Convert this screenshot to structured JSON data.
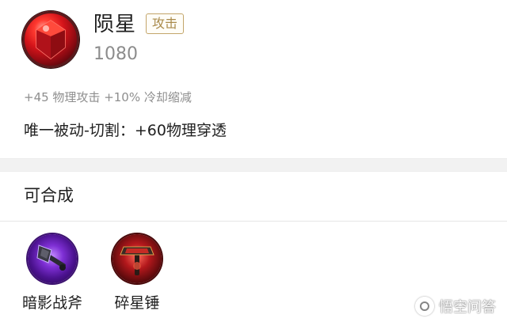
{
  "item": {
    "name": "陨星",
    "tag": "攻击",
    "price": "1080",
    "stats": "+45 物理攻击 +10% 冷却缩减",
    "passive": "唯一被动-切割：+60物理穿透",
    "icon": "red-gem-icon"
  },
  "craft": {
    "title": "可合成",
    "items": [
      {
        "label": "暗影战斧",
        "icon": "shadow-axe-icon"
      },
      {
        "label": "碎星锤",
        "icon": "star-hammer-icon"
      }
    ]
  },
  "watermark": {
    "text": "悟空问答",
    "icon": "wukong-logo-icon"
  },
  "colors": {
    "tag_border": "#c3a56a",
    "tag_text": "#a98a4a",
    "muted_text": "#8e8e8e",
    "separator": "#f2f2f2"
  }
}
